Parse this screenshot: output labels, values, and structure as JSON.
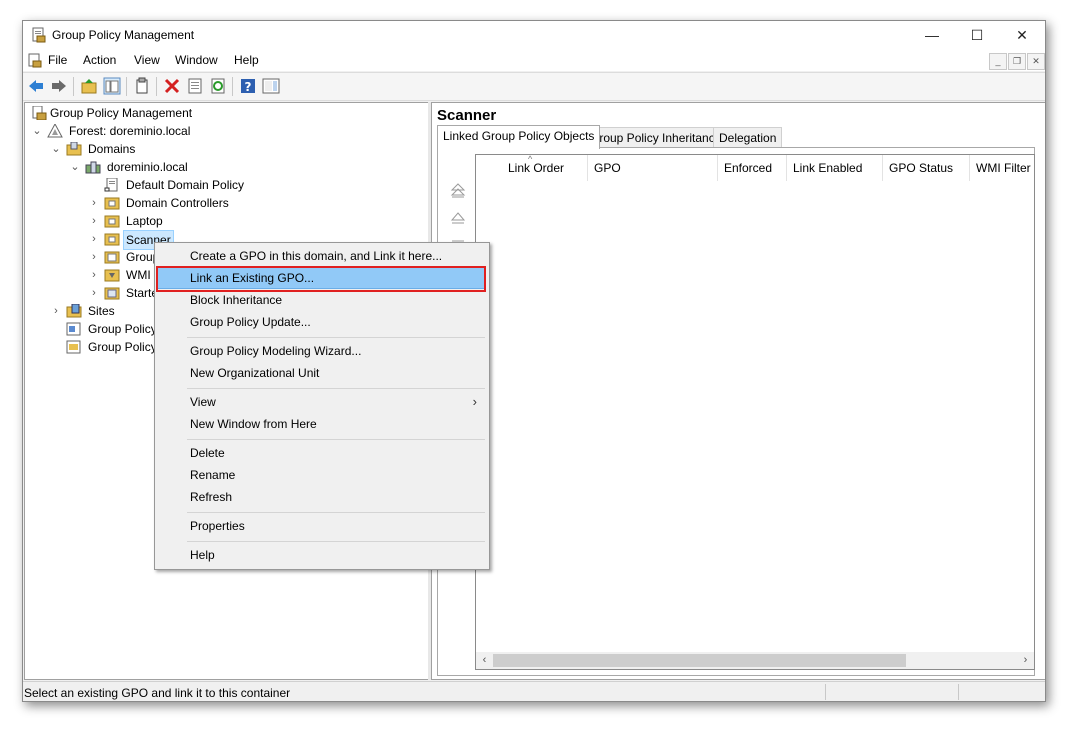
{
  "window": {
    "title": "Group Policy Management",
    "minimize": "—",
    "maximize": "☐",
    "close": "✕"
  },
  "menubar": {
    "items": [
      "File",
      "Action",
      "View",
      "Window",
      "Help"
    ]
  },
  "tree": {
    "items": [
      {
        "label": "Group Policy Management",
        "twisty": ""
      },
      {
        "label": "Forest: doreminio.local",
        "twisty": "⌄"
      },
      {
        "label": "Domains",
        "twisty": "⌄"
      },
      {
        "label": "doreminio.local",
        "twisty": "⌄"
      },
      {
        "label": "Default Domain Policy",
        "twisty": ""
      },
      {
        "label": "Domain Controllers",
        "twisty": "›"
      },
      {
        "label": "Laptop",
        "twisty": "›"
      },
      {
        "label": "Scanner",
        "twisty": "›"
      },
      {
        "label": "Group",
        "twisty": "›"
      },
      {
        "label": "WMI F",
        "twisty": "›"
      },
      {
        "label": "Starte",
        "twisty": "›"
      },
      {
        "label": "Sites",
        "twisty": "›"
      },
      {
        "label": "Group Policy",
        "twisty": ""
      },
      {
        "label": "Group Policy",
        "twisty": ""
      }
    ]
  },
  "right_pane": {
    "title": "Scanner",
    "tabs": [
      "Linked Group Policy Objects",
      "Group Policy Inheritance",
      "Delegation"
    ],
    "columns": [
      "Link Order",
      "GPO",
      "Enforced",
      "Link Enabled",
      "GPO Status",
      "WMI Filter"
    ],
    "scroll_left": "‹",
    "scroll_right": "›"
  },
  "context_menu": {
    "items": [
      "Create a GPO in this domain, and Link it here...",
      "Link an Existing GPO...",
      "Block Inheritance",
      "Group Policy Update...",
      "Group Policy Modeling Wizard...",
      "New Organizational Unit",
      "View",
      "New Window from Here",
      "Delete",
      "Rename",
      "Refresh",
      "Properties",
      "Help"
    ],
    "submenu_arrow": "›"
  },
  "status": {
    "text": "Select an existing GPO and link it to this container"
  },
  "colors": {
    "selection": "#cce8ff",
    "menu_highlight": "#91c9f7",
    "red_outline": "#e02020"
  }
}
